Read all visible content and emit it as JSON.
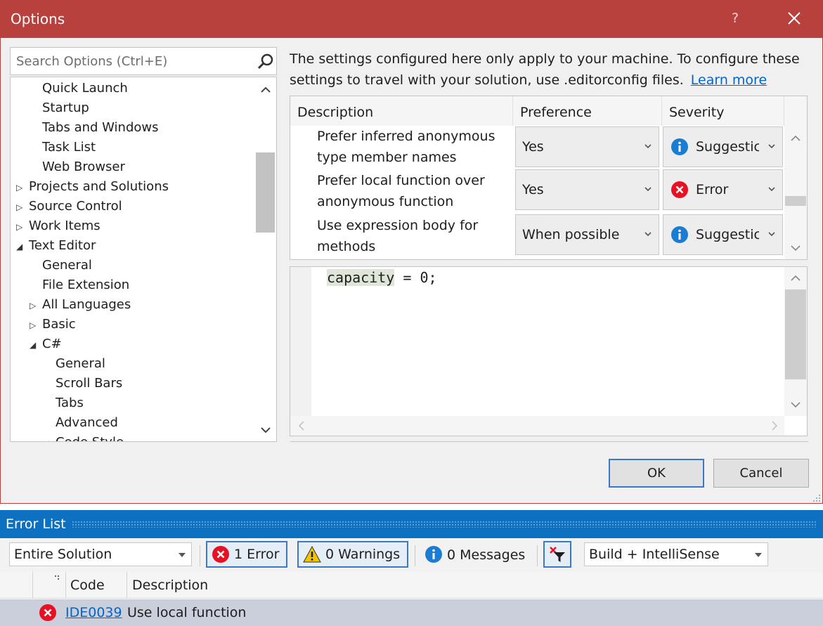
{
  "dialog": {
    "title": "Options",
    "help": "?",
    "search_placeholder": "Search Options (Ctrl+E)",
    "tree": [
      {
        "label": "Quick Launch",
        "level": 2,
        "expander": ""
      },
      {
        "label": "Startup",
        "level": 2,
        "expander": ""
      },
      {
        "label": "Tabs and Windows",
        "level": 2,
        "expander": ""
      },
      {
        "label": "Task List",
        "level": 2,
        "expander": ""
      },
      {
        "label": "Web Browser",
        "level": 2,
        "expander": ""
      },
      {
        "label": "Projects and Solutions",
        "level": 1,
        "expander": "▷"
      },
      {
        "label": "Source Control",
        "level": 1,
        "expander": "▷"
      },
      {
        "label": "Work Items",
        "level": 1,
        "expander": "▷"
      },
      {
        "label": "Text Editor",
        "level": 1,
        "expander": "◢"
      },
      {
        "label": "General",
        "level": 2,
        "expander": ""
      },
      {
        "label": "File Extension",
        "level": 2,
        "expander": ""
      },
      {
        "label": "All Languages",
        "level": 2,
        "expander": "▷"
      },
      {
        "label": "Basic",
        "level": 2,
        "expander": "▷"
      },
      {
        "label": "C#",
        "level": 2,
        "expander": "◢"
      },
      {
        "label": "General",
        "level": 3,
        "expander": ""
      },
      {
        "label": "Scroll Bars",
        "level": 3,
        "expander": ""
      },
      {
        "label": "Tabs",
        "level": 3,
        "expander": ""
      },
      {
        "label": "Advanced",
        "level": 3,
        "expander": ""
      },
      {
        "label": "Code Style",
        "level": 3,
        "expander": "◢"
      }
    ],
    "info_text": "The settings configured here only apply to your machine. To configure these settings to travel with your solution, use .editorconfig files.",
    "learn_more": "Learn more",
    "grid": {
      "headers": [
        "Description",
        "Preference",
        "Severity"
      ],
      "rows": [
        {
          "description": "Prefer inferred anonymous type member names",
          "preference": "Yes",
          "severity": "Suggestic",
          "severity_icon": "info-icon"
        },
        {
          "description": "Prefer local function over anonymous function",
          "preference": "Yes",
          "severity": "Error",
          "severity_icon": "error-icon"
        },
        {
          "description": "Use expression body for methods",
          "preference": "When possible",
          "severity": "Suggestic",
          "severity_icon": "info-icon"
        }
      ]
    },
    "preview_token": "capacity",
    "preview_rest": " = 0;",
    "ok": "OK",
    "cancel": "Cancel"
  },
  "error_list": {
    "title": "Error List",
    "scope": "Entire Solution",
    "errors": "1 Error",
    "warnings": "0 Warnings",
    "messages": "0 Messages",
    "source": "Build + IntelliSense",
    "columns": [
      "Code",
      "Description"
    ],
    "rows": [
      {
        "code": "IDE0039",
        "description": "Use local function"
      }
    ]
  },
  "colors": {
    "title_bar": "#b8403d",
    "error_list_header": "#0e70c0",
    "accent_border": "#3a79c9",
    "link": "#0066cc",
    "info_icon": "#1a7cd3",
    "error_icon": "#e81123",
    "warning_icon": "#f5c400"
  }
}
